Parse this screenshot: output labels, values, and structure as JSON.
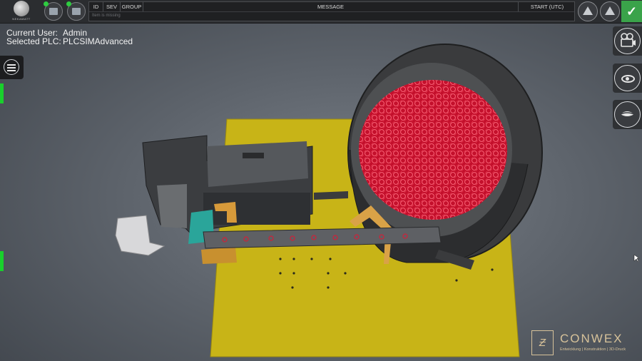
{
  "logo": {
    "text": "NEKAMATT"
  },
  "alarm_table": {
    "columns": {
      "id": "ID",
      "sev": "SEV",
      "group": "GROUP",
      "message": "MESSAGE",
      "start": "START (UTC)"
    },
    "empty_text": "Item is missing"
  },
  "status": {
    "current_user_label": "Current User:",
    "current_user": "Admin",
    "selected_plc_label": "Selected PLC:",
    "selected_plc": "PLCSIMAdvanced"
  },
  "icons": {
    "menu": "menu-icon",
    "camera": "film-camera-icon",
    "view": "eye-icon",
    "view_closed": "eye-closed-icon",
    "alarm_warning": "warning-list-icon",
    "alarm_ack": "acknowledge-icon",
    "ok": "checkmark-icon"
  },
  "colors": {
    "status_ok": "#2ecc40",
    "indicator": "#19d02c",
    "ok_button": "#3aa34a",
    "brand": "#d7c29a"
  },
  "brand": {
    "mark": "Ƶ",
    "name": "CONWEX",
    "tagline": "Entwicklung | Konstruktion | 3D-Druck"
  }
}
